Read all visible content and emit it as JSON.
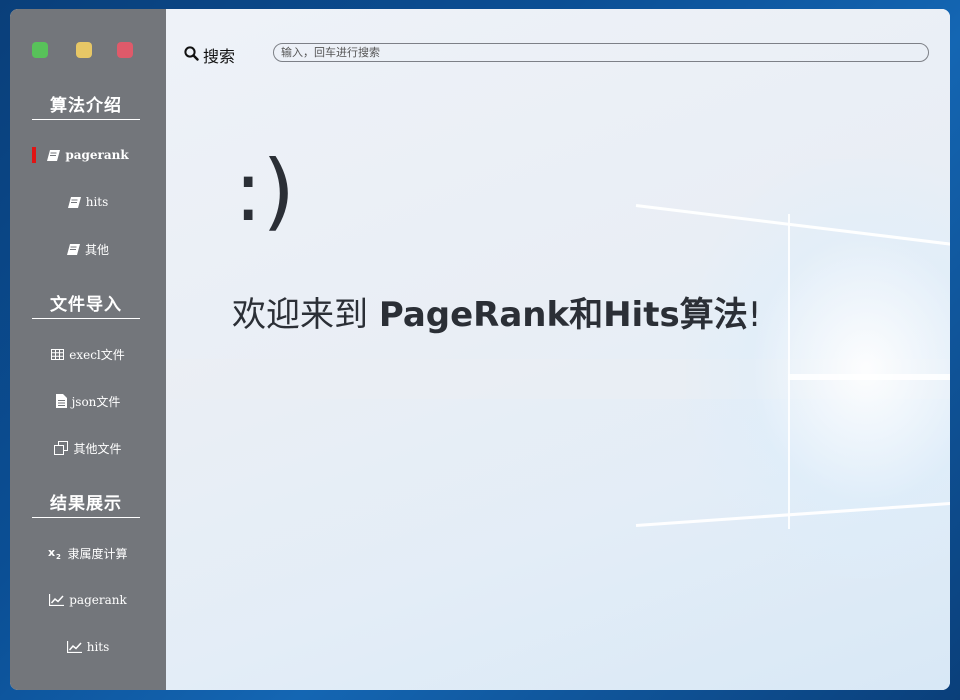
{
  "window_controls": {
    "close_color": "#df5a6a",
    "minimize_color": "#e7c766",
    "maximize_color": "#58c25a"
  },
  "sidebar": {
    "sections": [
      {
        "title": "算法介绍",
        "items": [
          {
            "label": "pagerank",
            "icon": "book-icon",
            "active": true
          },
          {
            "label": "hits",
            "icon": "book-icon"
          },
          {
            "label": "其他",
            "icon": "book-icon"
          }
        ]
      },
      {
        "title": "文件导入",
        "items": [
          {
            "label": "execl文件",
            "icon": "table-icon"
          },
          {
            "label": "json文件",
            "icon": "file-text-icon"
          },
          {
            "label": "其他文件",
            "icon": "copy-icon"
          }
        ]
      },
      {
        "title": "结果展示",
        "items": [
          {
            "label": "隶属度计算",
            "icon": "subscript-icon"
          },
          {
            "label": "pagerank",
            "icon": "line-chart-icon"
          },
          {
            "label": "hits",
            "icon": "line-chart-icon"
          }
        ]
      }
    ],
    "active_indicator_color": "#e11414"
  },
  "search": {
    "label": "搜索",
    "placeholder": "输入，回车进行搜索",
    "value": ""
  },
  "main": {
    "smiley": ":)",
    "welcome_prefix": "欢迎来到 ",
    "welcome_highlight": "PageRank和Hits算法",
    "welcome_suffix": "!"
  }
}
